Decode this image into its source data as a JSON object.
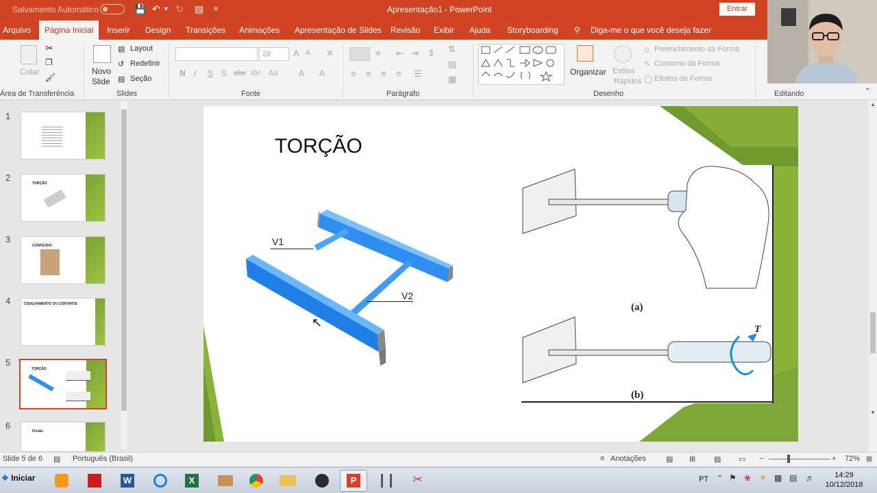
{
  "titlebar": {
    "autosave": "Salvamento Automático",
    "title": "Apresentação1 - PowerPoint",
    "entrar": "Entrar"
  },
  "menu": {
    "tabs": [
      "Arquivo",
      "Página Inicial",
      "Inserir",
      "Design",
      "Transições",
      "Animações",
      "Apresentação de Slides",
      "Revisão",
      "Exibir",
      "Ajuda",
      "Storyboarding"
    ],
    "tellme": "Diga-me o que você deseja fazer"
  },
  "ribbon": {
    "clipboard": {
      "colar": "Colar",
      "label": "Área de Transferência"
    },
    "slides": {
      "novo": "Novo",
      "slide": "Slide",
      "layout": "Layout",
      "redefinir": "Redefinir",
      "secao": "Seção",
      "label": "Slides"
    },
    "fonte": {
      "size": "28",
      "label": "Fonte",
      "styles": [
        "N",
        "I",
        "S",
        "S",
        "abc",
        "AV",
        "Aa",
        "A",
        "A"
      ]
    },
    "paragrafo": {
      "label": "Parágrafo"
    },
    "desenho": {
      "organizar": "Organizar",
      "estilos": "Estilos",
      "rapidos": "Rápidos",
      "preenchimento": "Preenchimento da Forma",
      "contorno": "Contorno da Forma",
      "efeitos": "Efeitos de Forma",
      "label": "Desenho"
    },
    "editando": {
      "label": "Editando"
    }
  },
  "thumbnails": [
    {
      "num": "1",
      "title": ""
    },
    {
      "num": "2",
      "title": "TORÇÃO"
    },
    {
      "num": "3",
      "title": "CONTEÚDO"
    },
    {
      "num": "4",
      "title": "CISALHAMENTO OU CORTANTE"
    },
    {
      "num": "5",
      "title": "TORÇÃO"
    },
    {
      "num": "6",
      "title": "Flexão"
    }
  ],
  "slide": {
    "title": "TORÇÃO",
    "label_v1": "V1",
    "label_v2": "V2",
    "caption_a": "(a)",
    "caption_b": "(b)",
    "torque": "T"
  },
  "status": {
    "slide_of": "Slide 5 de 6",
    "language": "Português (Brasil)",
    "notes": "Anotações",
    "zoom": "72%"
  },
  "taskbar": {
    "start": "Iniciar",
    "lang": "PT",
    "time": "14:29",
    "date": "10/12/2018"
  },
  "colors": {
    "accent": "#d04423",
    "slide_green": "#8ab33a",
    "beam_blue": "#2f8ef0"
  }
}
